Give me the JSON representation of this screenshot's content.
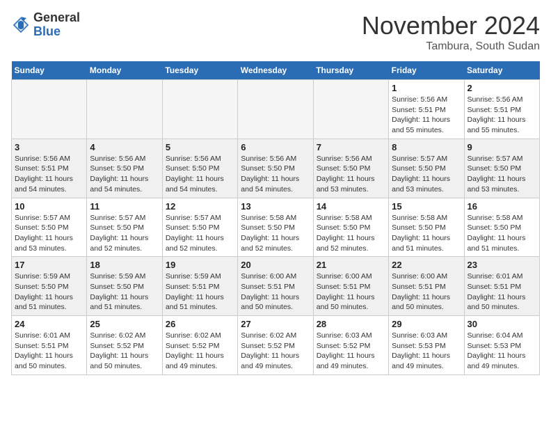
{
  "header": {
    "logo_general": "General",
    "logo_blue": "Blue",
    "month_title": "November 2024",
    "location": "Tambura, South Sudan"
  },
  "days_of_week": [
    "Sunday",
    "Monday",
    "Tuesday",
    "Wednesday",
    "Thursday",
    "Friday",
    "Saturday"
  ],
  "weeks": [
    [
      {
        "day": "",
        "info": ""
      },
      {
        "day": "",
        "info": ""
      },
      {
        "day": "",
        "info": ""
      },
      {
        "day": "",
        "info": ""
      },
      {
        "day": "",
        "info": ""
      },
      {
        "day": "1",
        "info": "Sunrise: 5:56 AM\nSunset: 5:51 PM\nDaylight: 11 hours\nand 55 minutes."
      },
      {
        "day": "2",
        "info": "Sunrise: 5:56 AM\nSunset: 5:51 PM\nDaylight: 11 hours\nand 55 minutes."
      }
    ],
    [
      {
        "day": "3",
        "info": "Sunrise: 5:56 AM\nSunset: 5:51 PM\nDaylight: 11 hours\nand 54 minutes."
      },
      {
        "day": "4",
        "info": "Sunrise: 5:56 AM\nSunset: 5:50 PM\nDaylight: 11 hours\nand 54 minutes."
      },
      {
        "day": "5",
        "info": "Sunrise: 5:56 AM\nSunset: 5:50 PM\nDaylight: 11 hours\nand 54 minutes."
      },
      {
        "day": "6",
        "info": "Sunrise: 5:56 AM\nSunset: 5:50 PM\nDaylight: 11 hours\nand 54 minutes."
      },
      {
        "day": "7",
        "info": "Sunrise: 5:56 AM\nSunset: 5:50 PM\nDaylight: 11 hours\nand 53 minutes."
      },
      {
        "day": "8",
        "info": "Sunrise: 5:57 AM\nSunset: 5:50 PM\nDaylight: 11 hours\nand 53 minutes."
      },
      {
        "day": "9",
        "info": "Sunrise: 5:57 AM\nSunset: 5:50 PM\nDaylight: 11 hours\nand 53 minutes."
      }
    ],
    [
      {
        "day": "10",
        "info": "Sunrise: 5:57 AM\nSunset: 5:50 PM\nDaylight: 11 hours\nand 53 minutes."
      },
      {
        "day": "11",
        "info": "Sunrise: 5:57 AM\nSunset: 5:50 PM\nDaylight: 11 hours\nand 52 minutes."
      },
      {
        "day": "12",
        "info": "Sunrise: 5:57 AM\nSunset: 5:50 PM\nDaylight: 11 hours\nand 52 minutes."
      },
      {
        "day": "13",
        "info": "Sunrise: 5:58 AM\nSunset: 5:50 PM\nDaylight: 11 hours\nand 52 minutes."
      },
      {
        "day": "14",
        "info": "Sunrise: 5:58 AM\nSunset: 5:50 PM\nDaylight: 11 hours\nand 52 minutes."
      },
      {
        "day": "15",
        "info": "Sunrise: 5:58 AM\nSunset: 5:50 PM\nDaylight: 11 hours\nand 51 minutes."
      },
      {
        "day": "16",
        "info": "Sunrise: 5:58 AM\nSunset: 5:50 PM\nDaylight: 11 hours\nand 51 minutes."
      }
    ],
    [
      {
        "day": "17",
        "info": "Sunrise: 5:59 AM\nSunset: 5:50 PM\nDaylight: 11 hours\nand 51 minutes."
      },
      {
        "day": "18",
        "info": "Sunrise: 5:59 AM\nSunset: 5:50 PM\nDaylight: 11 hours\nand 51 minutes."
      },
      {
        "day": "19",
        "info": "Sunrise: 5:59 AM\nSunset: 5:51 PM\nDaylight: 11 hours\nand 51 minutes."
      },
      {
        "day": "20",
        "info": "Sunrise: 6:00 AM\nSunset: 5:51 PM\nDaylight: 11 hours\nand 50 minutes."
      },
      {
        "day": "21",
        "info": "Sunrise: 6:00 AM\nSunset: 5:51 PM\nDaylight: 11 hours\nand 50 minutes."
      },
      {
        "day": "22",
        "info": "Sunrise: 6:00 AM\nSunset: 5:51 PM\nDaylight: 11 hours\nand 50 minutes."
      },
      {
        "day": "23",
        "info": "Sunrise: 6:01 AM\nSunset: 5:51 PM\nDaylight: 11 hours\nand 50 minutes."
      }
    ],
    [
      {
        "day": "24",
        "info": "Sunrise: 6:01 AM\nSunset: 5:51 PM\nDaylight: 11 hours\nand 50 minutes."
      },
      {
        "day": "25",
        "info": "Sunrise: 6:02 AM\nSunset: 5:52 PM\nDaylight: 11 hours\nand 50 minutes."
      },
      {
        "day": "26",
        "info": "Sunrise: 6:02 AM\nSunset: 5:52 PM\nDaylight: 11 hours\nand 49 minutes."
      },
      {
        "day": "27",
        "info": "Sunrise: 6:02 AM\nSunset: 5:52 PM\nDaylight: 11 hours\nand 49 minutes."
      },
      {
        "day": "28",
        "info": "Sunrise: 6:03 AM\nSunset: 5:52 PM\nDaylight: 11 hours\nand 49 minutes."
      },
      {
        "day": "29",
        "info": "Sunrise: 6:03 AM\nSunset: 5:53 PM\nDaylight: 11 hours\nand 49 minutes."
      },
      {
        "day": "30",
        "info": "Sunrise: 6:04 AM\nSunset: 5:53 PM\nDaylight: 11 hours\nand 49 minutes."
      }
    ]
  ]
}
